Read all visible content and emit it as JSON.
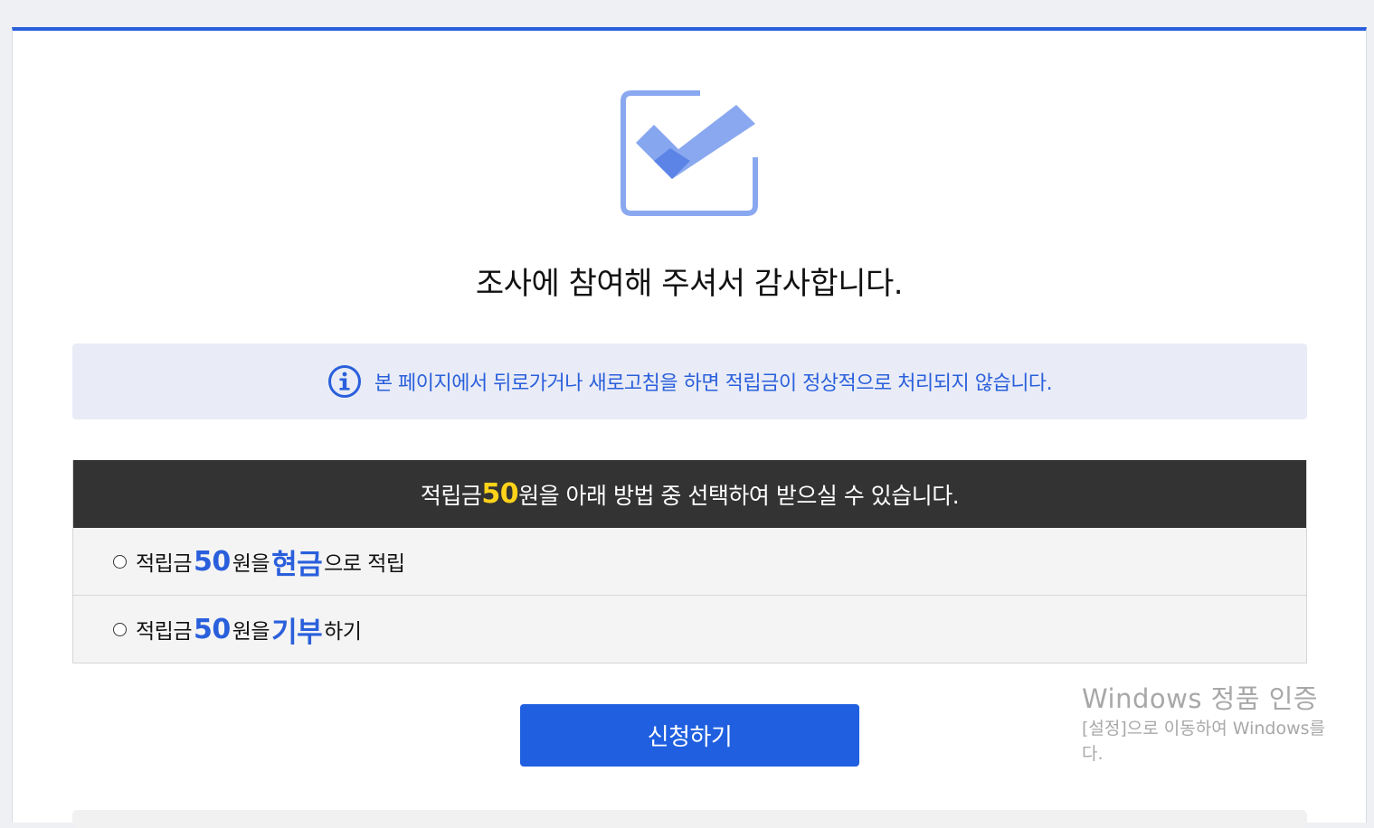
{
  "page": {
    "title": "조사에 참여해 주셔서 감사합니다.",
    "accent_color": "#2a5fdc",
    "icon": "check-box-icon"
  },
  "notice": {
    "icon": "info-icon",
    "text": "본 페이지에서 뒤로가거나 새로고침을 하면 적립금이 정상적으로 처리되지 않습니다."
  },
  "reward": {
    "header_prefix": "적립금 ",
    "amount": "50",
    "header_suffix": "원을 아래 방법 중 선택하여 받으실 수 있습니다.",
    "options": [
      {
        "prefix": "적립금 ",
        "amount": "50",
        "middle": "원을 ",
        "method": "현금",
        "suffix": "으로 적립",
        "selected": false
      },
      {
        "prefix": "적립금 ",
        "amount": "50",
        "middle": "원을 ",
        "method": "기부",
        "suffix": "하기",
        "selected": false
      }
    ]
  },
  "submit_label": "신청하기",
  "watermark": {
    "title": "Windows 정품 인증",
    "line1": "[설정]으로 이동하여 Windows를",
    "line2": "다."
  }
}
